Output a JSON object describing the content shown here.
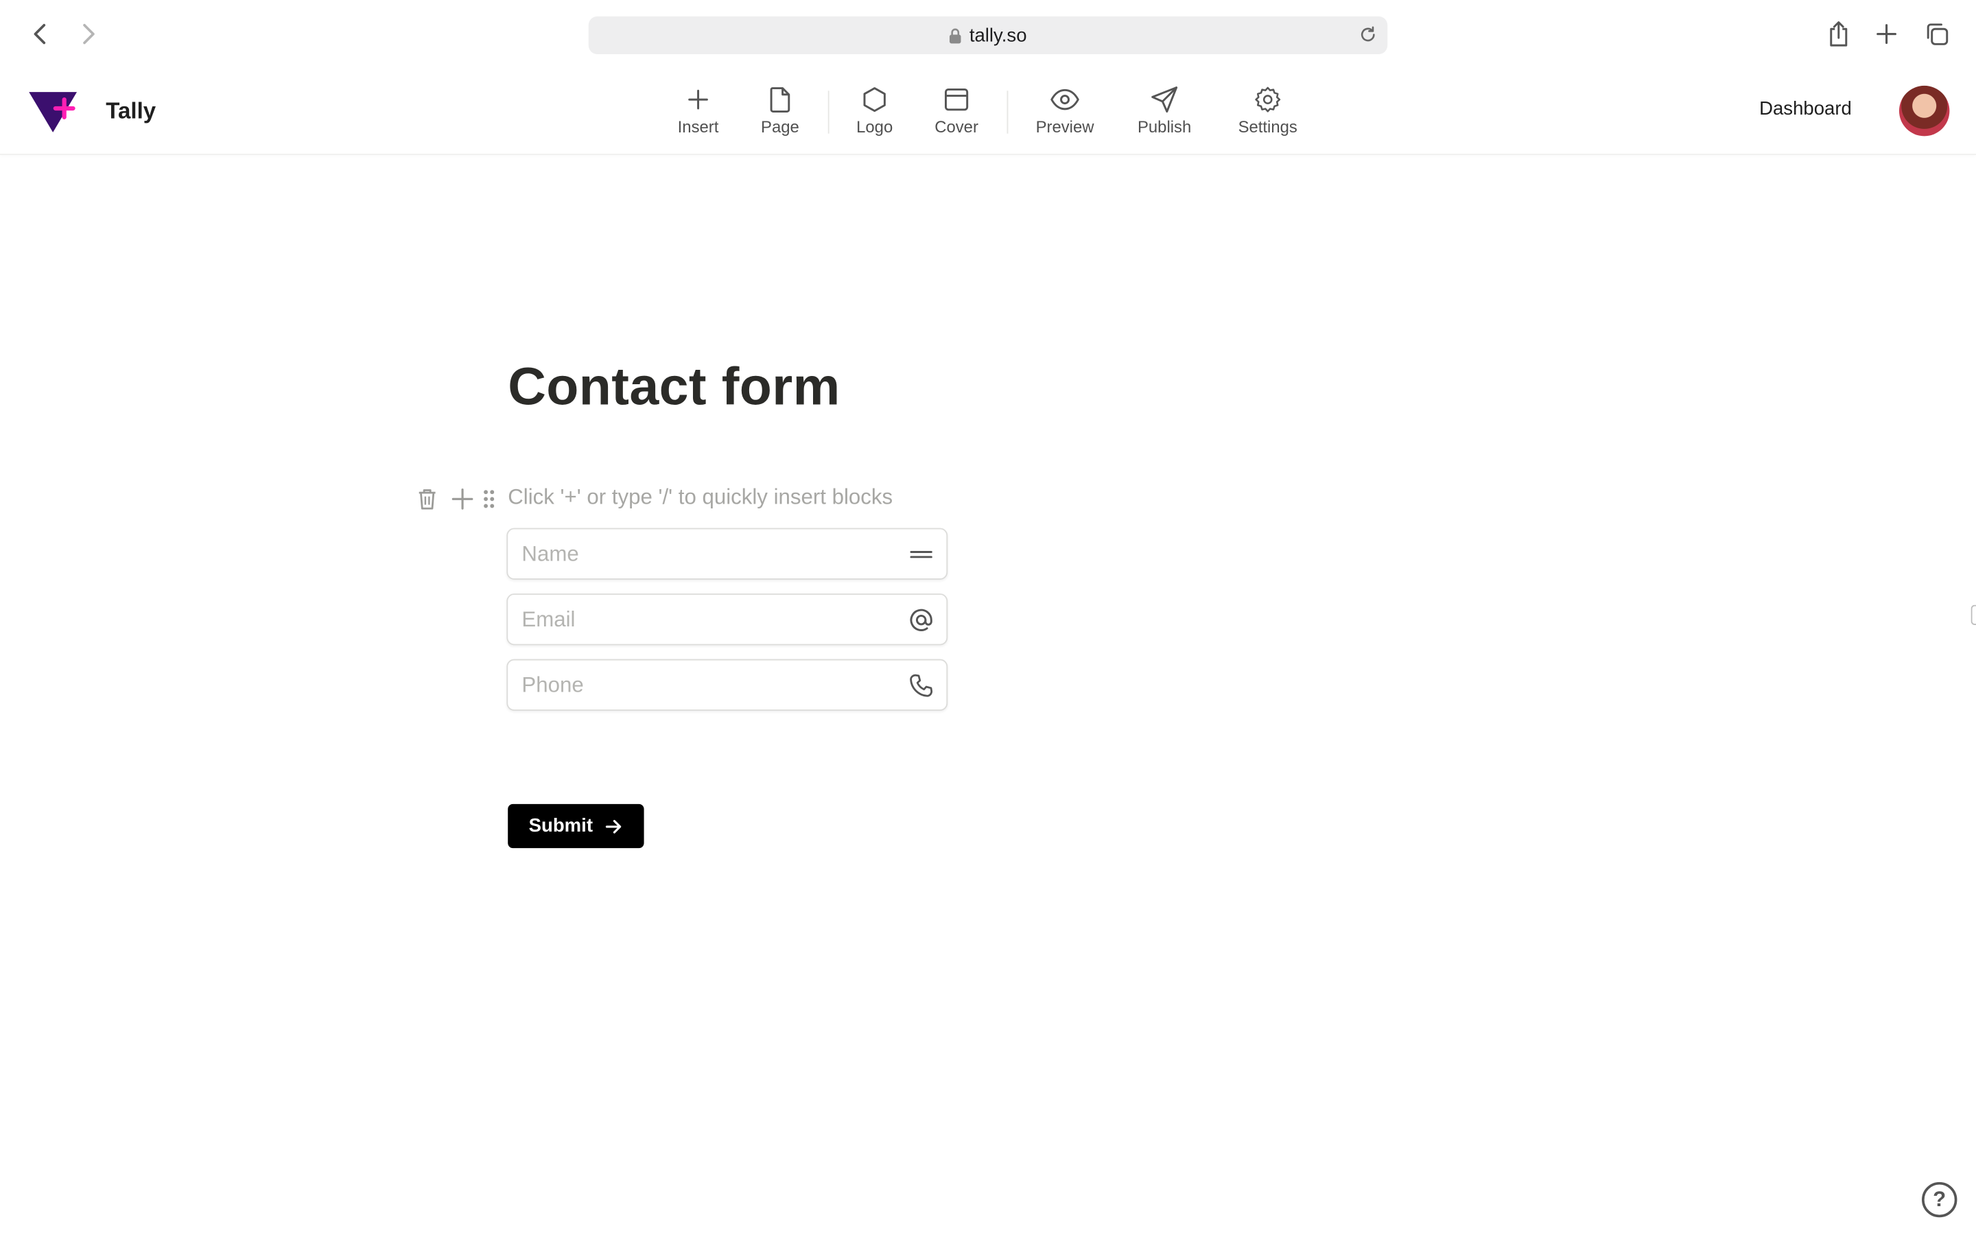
{
  "browser": {
    "url": "tally.so"
  },
  "app": {
    "name": "Tally",
    "brand_colors": {
      "logo_dark": "#3b0f6e",
      "logo_accent": "#ff1fb4"
    }
  },
  "toolbar": {
    "items": [
      {
        "label": "Insert",
        "icon": "plus-icon"
      },
      {
        "label": "Page",
        "icon": "page-icon"
      },
      {
        "label": "Logo",
        "icon": "hexagon-icon"
      },
      {
        "label": "Cover",
        "icon": "cover-icon"
      },
      {
        "label": "Preview",
        "icon": "eye-icon"
      },
      {
        "label": "Publish",
        "icon": "send-icon"
      },
      {
        "label": "Settings",
        "icon": "gear-icon"
      }
    ],
    "dashboard_label": "Dashboard"
  },
  "form": {
    "title": "Contact form",
    "hint": "Click '+' or type '/' to quickly insert blocks",
    "fields": [
      {
        "placeholder": "Name",
        "icon": "short-text-icon"
      },
      {
        "placeholder": "Email",
        "icon": "at-icon"
      },
      {
        "placeholder": "Phone",
        "icon": "phone-icon"
      }
    ],
    "submit_label": "Submit"
  },
  "help": {
    "label": "?"
  }
}
